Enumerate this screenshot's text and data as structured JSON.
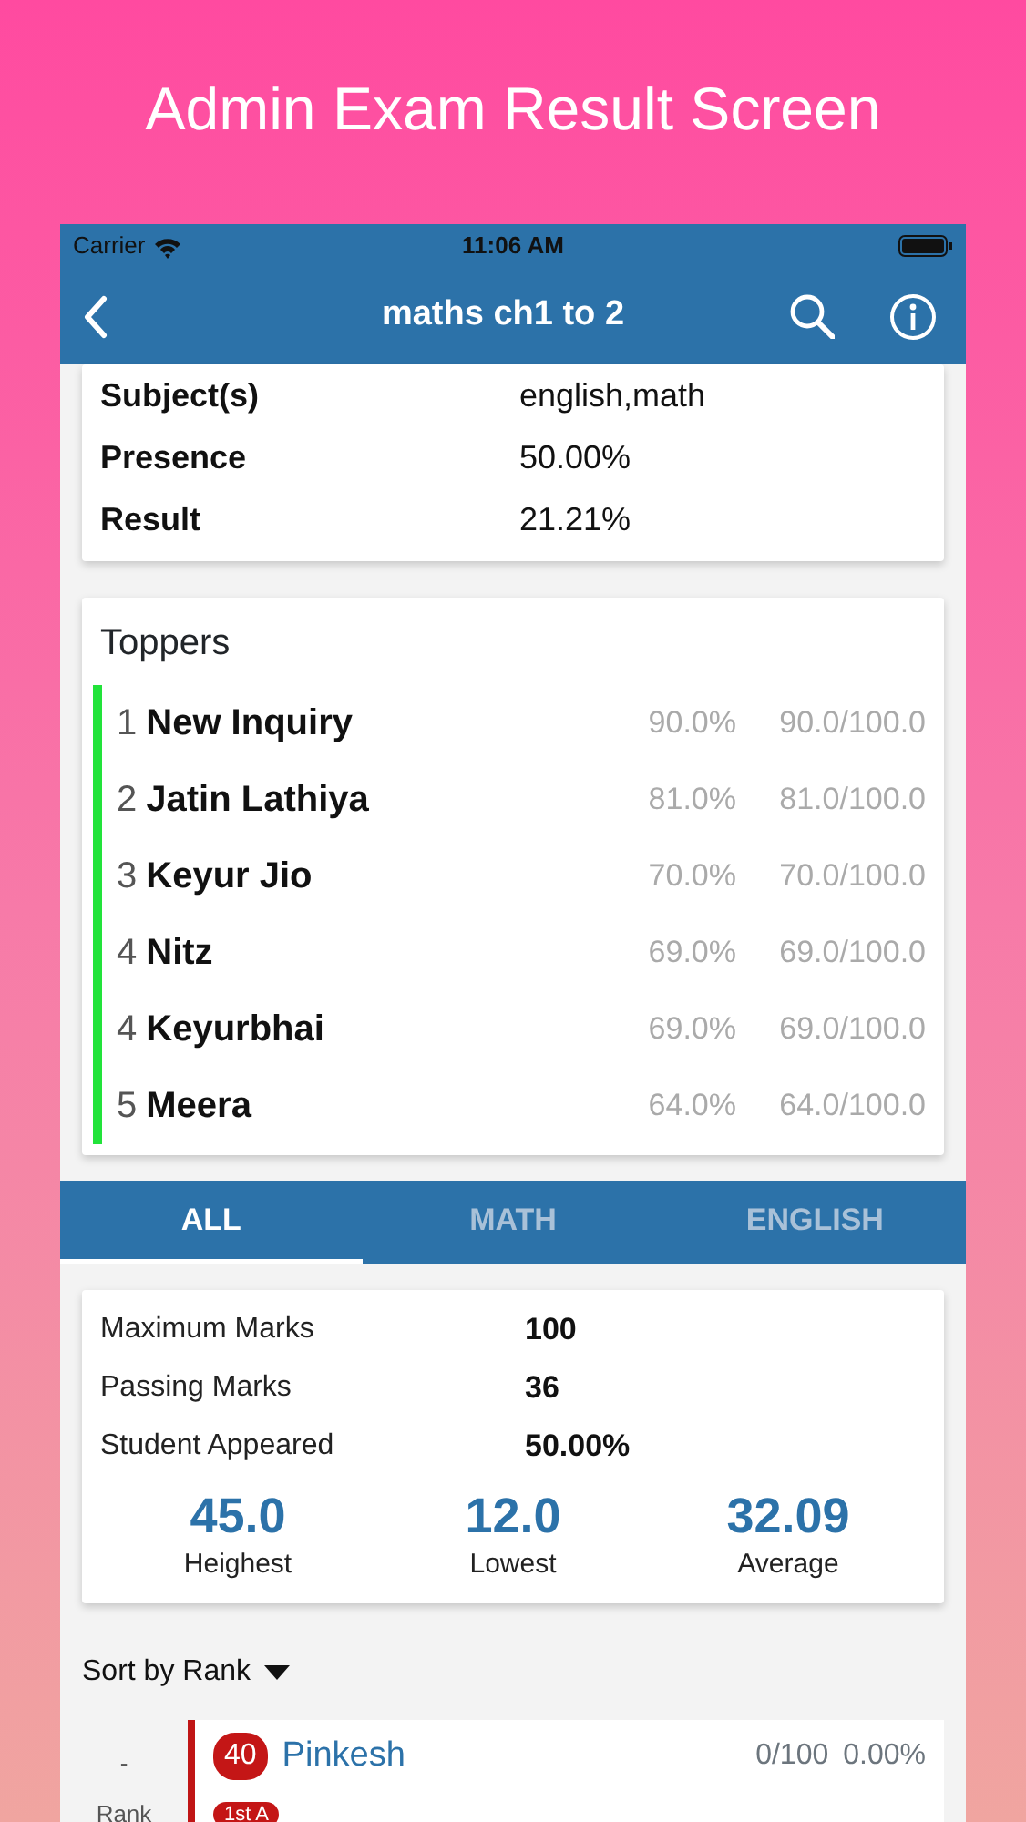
{
  "headline": "Admin Exam Result Screen",
  "status_bar": {
    "carrier": "Carrier",
    "time": "11:06 AM"
  },
  "nav": {
    "title": "maths ch1 to 2"
  },
  "summary": [
    {
      "label": "Subject(s)",
      "value": "english,math"
    },
    {
      "label": "Presence",
      "value": "50.00%"
    },
    {
      "label": "Result",
      "value": "21.21%"
    }
  ],
  "toppers": {
    "title": "Toppers",
    "items": [
      {
        "rank": "1",
        "name": "New Inquiry",
        "percent": "90.0%",
        "score": "90.0/100.0"
      },
      {
        "rank": "2",
        "name": "Jatin Lathiya",
        "percent": "81.0%",
        "score": "81.0/100.0"
      },
      {
        "rank": "3",
        "name": "Keyur Jio",
        "percent": "70.0%",
        "score": "70.0/100.0"
      },
      {
        "rank": "4",
        "name": "Nitz",
        "percent": "69.0%",
        "score": "69.0/100.0"
      },
      {
        "rank": "4",
        "name": "Keyurbhai",
        "percent": "69.0%",
        "score": "69.0/100.0"
      },
      {
        "rank": "5",
        "name": "Meera",
        "percent": "64.0%",
        "score": "64.0/100.0"
      }
    ]
  },
  "tabs": [
    {
      "label": "ALL",
      "selected": true
    },
    {
      "label": "MATH",
      "selected": false
    },
    {
      "label": "ENGLISH",
      "selected": false
    }
  ],
  "marks": [
    {
      "label": "Maximum Marks",
      "value": "100"
    },
    {
      "label": "Passing Marks",
      "value": "36"
    },
    {
      "label": "Student Appeared",
      "value": "50.00%"
    }
  ],
  "stats": [
    {
      "value": "45.0",
      "label": "Heighest"
    },
    {
      "value": "12.0",
      "label": "Lowest"
    },
    {
      "value": "32.09",
      "label": "Average"
    }
  ],
  "sort": {
    "label": "Sort by Rank"
  },
  "students": [
    {
      "rank": "-",
      "rank_label": "Rank",
      "roll": "40",
      "name": "Pinkesh",
      "score": "0/100",
      "percent": "0.00%",
      "grade": "1st A"
    }
  ]
}
